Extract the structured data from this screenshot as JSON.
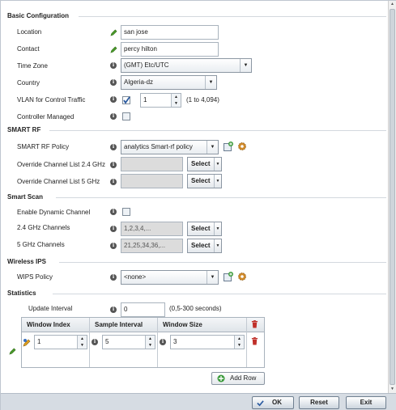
{
  "sections": {
    "basic": "Basic Configuration",
    "smart_rf": "SMART RF",
    "smart_scan": "Smart Scan",
    "wireless_ips": "Wireless IPS",
    "statistics": "Statistics"
  },
  "basic": {
    "location_label": "Location",
    "location_value": "san jose",
    "contact_label": "Contact",
    "contact_value": "percy hilton",
    "timezone_label": "Time Zone",
    "timezone_value": "(GMT) Etc/UTC",
    "country_label": "Country",
    "country_value": "Algeria-dz",
    "vlan_label": "VLAN for Control Traffic",
    "vlan_value": "1",
    "vlan_range": "(1 to 4,094)",
    "controller_label": "Controller Managed"
  },
  "smart_rf": {
    "policy_label": "SMART RF Policy",
    "policy_value": "analytics Smart-rf policy",
    "override24_label": "Override Channel List 2.4 GHz",
    "override5_label": "Override Channel List 5 GHz",
    "select_label": "Select"
  },
  "smart_scan": {
    "enable_label": "Enable Dynamic Channel",
    "ch24_label": "2.4 GHz Channels",
    "ch24_value": "1,2,3,4,...",
    "ch5_label": "5 GHz Channels",
    "ch5_value": "21,25,34,36,...",
    "select_label": "Select"
  },
  "wips": {
    "policy_label": "WIPS Policy",
    "policy_value": "<none>"
  },
  "statistics": {
    "update_label": "Update Interval",
    "update_value": "0",
    "update_range": "(0,5-300 seconds)",
    "columns": [
      "Window Index",
      "Sample Interval",
      "Window Size"
    ],
    "row": {
      "window_index": "1",
      "sample_interval": "5",
      "window_size": "3"
    },
    "add_row": "Add Row"
  },
  "footer": {
    "ok": "OK",
    "reset": "Reset",
    "exit": "Exit"
  },
  "colors": {
    "info_icon": "#555555",
    "pencil_green": "#4a9a2a",
    "trash_red": "#c0302a",
    "checkbox_check": "#2a5aa0"
  }
}
